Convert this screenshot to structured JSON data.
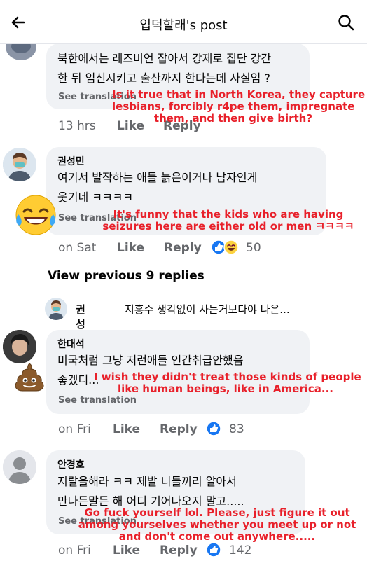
{
  "header": {
    "title": "입덕할래's post",
    "back_icon": "back-arrow-icon",
    "search_icon": "search-icon"
  },
  "comments": [
    {
      "lines": [
        "북한에서는 레즈비언 잡아서 강제로 집단 강간",
        "한 뒤 임신시키고 출산까지 한다는데 사실임 ?"
      ],
      "see_translation": "See translation",
      "time": "13 hrs",
      "like": "Like",
      "reply": "Reply",
      "overlay": [
        "Is it true that in North Korea, they capture",
        "lesbians, forcibly r4pe them, impregnate",
        "them, and then give birth?"
      ]
    },
    {
      "name": "권성민",
      "lines": [
        "여기서 발작하는 애들 늙은이거나 남자인게",
        "웃기네 ㅋㅋㅋㅋ"
      ],
      "see_translation": "See translation",
      "time": "on Sat",
      "like": "Like",
      "reply": "Reply",
      "reactions": "50",
      "overlay": [
        "It's funny that the kids who are having",
        "seizures here are either old or men ㅋㅋㅋㅋ"
      ]
    },
    {
      "name": "한대석",
      "lines": [
        "미국처럼 그냥 저런애들 인간취급안했음",
        "좋겠디..."
      ],
      "see_translation": "See translation",
      "time": "on Fri",
      "like": "Like",
      "reply": "Reply",
      "reactions": "83",
      "overlay": [
        "I wish they didn't treat those kinds of people",
        "like human beings, like in America..."
      ]
    },
    {
      "name": "안경호",
      "lines": [
        "지랄을해라 ㅋㅋ 제발 니들끼리 알아서",
        "만나든말든 해 어디 기어나오지 말고....."
      ],
      "see_translation": "See translation",
      "time": "on Fri",
      "like": "Like",
      "reply": "Reply",
      "reactions": "142",
      "overlay": [
        "Go fuck yourself lol. Please, just figure it out",
        "among yourselves whether you meet up or not",
        "and don't come out anywhere....."
      ]
    }
  ],
  "view_previous": "View previous 9 replies",
  "collapsed_reply": {
    "name": "권성민",
    "text": "지홍수 생각없이 사는거보다야 나은..."
  },
  "colors": {
    "overlay": "#e8202a",
    "like_blue": "#1877f2",
    "bubble": "#f0f2f5"
  }
}
